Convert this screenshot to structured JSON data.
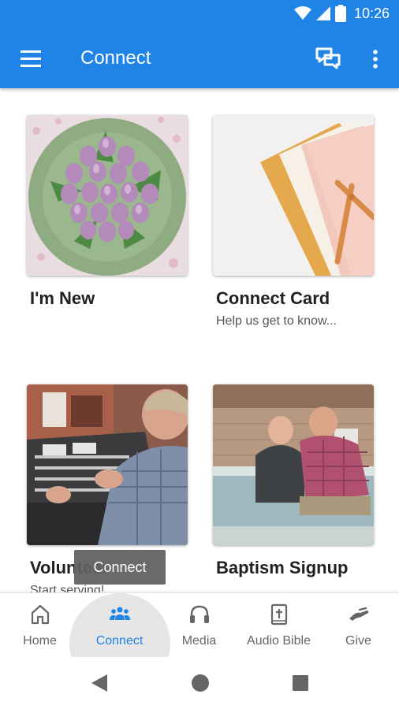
{
  "status_bar": {
    "time": "10:26",
    "icons": [
      "wifi-icon",
      "signal-icon",
      "battery-icon"
    ]
  },
  "toolbar": {
    "title": "Connect",
    "menu_icon": "hamburger-menu-icon",
    "actions": [
      "chat-bubbles-icon",
      "more-vert-icon"
    ]
  },
  "cards": [
    {
      "title": "I'm New",
      "subtitle": "",
      "image": "flower-bouquet-photo"
    },
    {
      "title": "Connect Card",
      "subtitle": "Help us get to know...",
      "image": "stationery-pen-photo"
    },
    {
      "title": "Volunteer",
      "subtitle": "Start serving!",
      "image": "soundboard-operator-photo"
    },
    {
      "title": "Baptism Signup",
      "subtitle": "",
      "image": "baptism-pool-photo"
    }
  ],
  "tooltip": {
    "text": "Connect"
  },
  "bottom_nav": {
    "active": "Connect",
    "items": [
      {
        "label": "Home",
        "icon": "home-icon"
      },
      {
        "label": "Connect",
        "icon": "people-icon"
      },
      {
        "label": "Media",
        "icon": "headphones-icon"
      },
      {
        "label": "Audio Bible",
        "icon": "bible-icon"
      },
      {
        "label": "Give",
        "icon": "give-hand-icon"
      }
    ]
  },
  "system_nav": [
    "back-icon",
    "home-circle-icon",
    "recents-square-icon"
  ],
  "colors": {
    "primary": "#1f84e6",
    "text": "#202124",
    "inactive": "#666666"
  }
}
